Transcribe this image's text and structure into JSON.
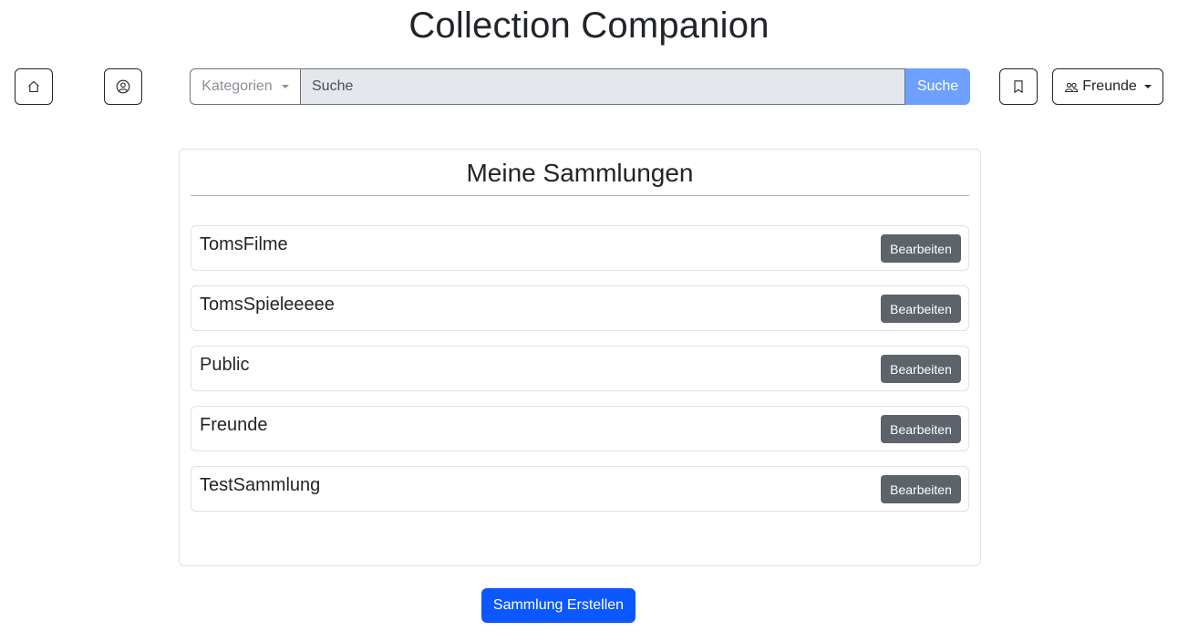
{
  "app": {
    "title": "Collection Companion"
  },
  "nav": {
    "home_icon": "house-icon",
    "profile_icon": "person-circle-icon",
    "bookmark_icon": "bookmark-icon",
    "categories_label": "Kategorien",
    "search_placeholder": "Suche",
    "search_button_label": "Suche",
    "friends_label": "Freunde",
    "friends_icon": "people-icon"
  },
  "collections": {
    "title": "Meine Sammlungen",
    "edit_label": "Bearbeiten",
    "items": [
      {
        "name": "TomsFilme"
      },
      {
        "name": "TomsSpieleeeee"
      },
      {
        "name": "Public"
      },
      {
        "name": "Freunde"
      },
      {
        "name": "TestSammlung"
      }
    ]
  },
  "actions": {
    "create_label": "Sammlung Erstellen"
  },
  "colors": {
    "search_button": "#6ea0ff",
    "primary": "#0d57ff",
    "secondary": "#5c636a",
    "input_bg": "#e4e7eb"
  }
}
